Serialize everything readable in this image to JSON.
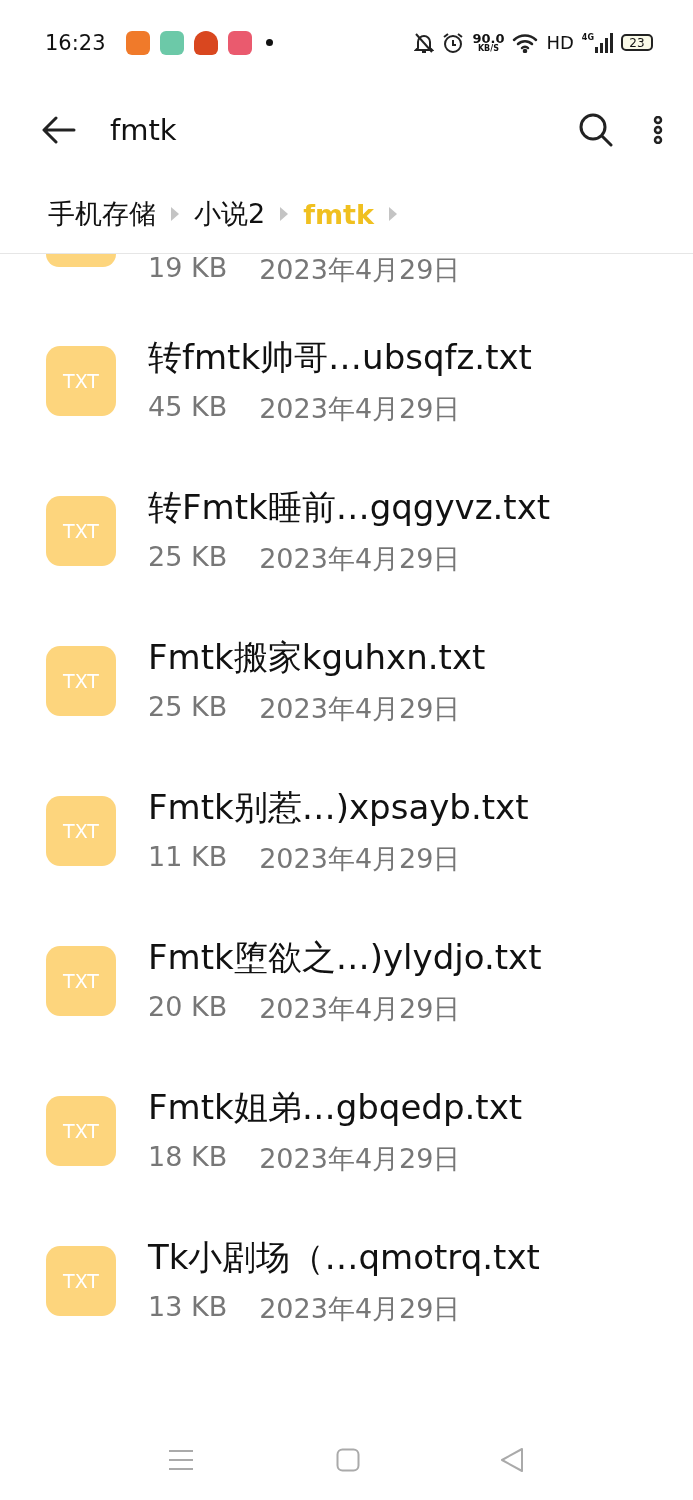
{
  "status_bar": {
    "time": "16:23",
    "speed": "90.0",
    "speed_unit": "KB/S",
    "network": "HD",
    "cell_type": "4G",
    "battery": "23"
  },
  "toolbar": {
    "title": "fmtk"
  },
  "breadcrumb": [
    {
      "label": "手机存储",
      "selected": false
    },
    {
      "label": "小说2",
      "selected": false
    },
    {
      "label": "fmtk",
      "selected": true
    }
  ],
  "partial_file": {
    "size": "19 KB",
    "date": "2023年4月29日"
  },
  "files": [
    {
      "icon_label": "TXT",
      "name": "转fmtk帅哥…ubsqfz.txt",
      "size": "45 KB",
      "date": "2023年4月29日"
    },
    {
      "icon_label": "TXT",
      "name": "转Fmtk睡前…gqgyvz.txt",
      "size": "25 KB",
      "date": "2023年4月29日"
    },
    {
      "icon_label": "TXT",
      "name": "Fmtk搬家kguhxn.txt",
      "size": "25 KB",
      "date": "2023年4月29日"
    },
    {
      "icon_label": "TXT",
      "name": "Fmtk别惹…)xpsayb.txt",
      "size": "11 KB",
      "date": "2023年4月29日"
    },
    {
      "icon_label": "TXT",
      "name": "Fmtk堕欲之…)ylydjo.txt",
      "size": "20 KB",
      "date": "2023年4月29日"
    },
    {
      "icon_label": "TXT",
      "name": "Fmtk姐弟…gbqedp.txt",
      "size": "18 KB",
      "date": "2023年4月29日"
    },
    {
      "icon_label": "TXT",
      "name": "Tk小剧场（…qmotrq.txt",
      "size": "13 KB",
      "date": "2023年4月29日"
    }
  ]
}
